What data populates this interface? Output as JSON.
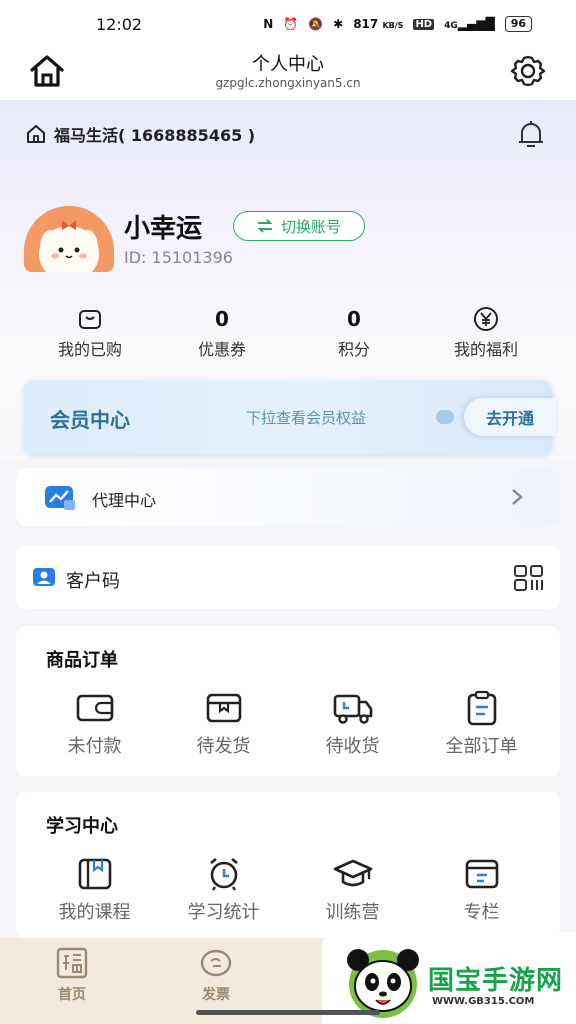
{
  "status_bar": {
    "time": "12:02",
    "net_speed": "817",
    "net_unit": "KB/S",
    "hd": "HD",
    "signal": "4G",
    "battery": "96"
  },
  "nav": {
    "title": "个人中心",
    "url": "gzpglc.zhongxinyan5.cn"
  },
  "shop": {
    "name": "福马生活( 1668885465 )"
  },
  "user": {
    "name": "小幸运",
    "switch_label": "切换账号",
    "id": "ID: 15101396"
  },
  "stats": [
    {
      "value": "",
      "label": "我的已购",
      "icon": "bag-icon"
    },
    {
      "value": "0",
      "label": "优惠券"
    },
    {
      "value": "0",
      "label": "积分"
    },
    {
      "value": "",
      "label": "我的福利",
      "icon": "yen-icon"
    }
  ],
  "member": {
    "title": "会员中心",
    "hint": "下拉查看会员权益",
    "action": "去开通"
  },
  "agent": {
    "label": "代理中心"
  },
  "customer": {
    "label": "客户码"
  },
  "orders": {
    "title": "商品订单",
    "items": [
      {
        "label": "未付款",
        "icon": "wallet-icon"
      },
      {
        "label": "待发货",
        "icon": "box-icon"
      },
      {
        "label": "待收货",
        "icon": "truck-icon"
      },
      {
        "label": "全部订单",
        "icon": "clipboard-icon"
      }
    ]
  },
  "study": {
    "title": "学习中心",
    "items": [
      {
        "label": "我的课程",
        "icon": "book-icon"
      },
      {
        "label": "学习统计",
        "icon": "alarm-clock-icon"
      },
      {
        "label": "训练营",
        "icon": "graduation-cap-icon"
      },
      {
        "label": "专栏",
        "icon": "column-icon"
      }
    ]
  },
  "bottom_nav": {
    "tabs": [
      {
        "label": "首页",
        "icon": "home-fortune-icon"
      },
      {
        "label": "发票",
        "icon": "invoice-icon"
      }
    ]
  },
  "watermark": {
    "brand": "国宝手游网",
    "url": "WWW.GB315.COM"
  },
  "colors": {
    "accent_green": "#2ea86b",
    "member_blue": "#2f6f9a",
    "tab_brown": "#9a8a72"
  }
}
